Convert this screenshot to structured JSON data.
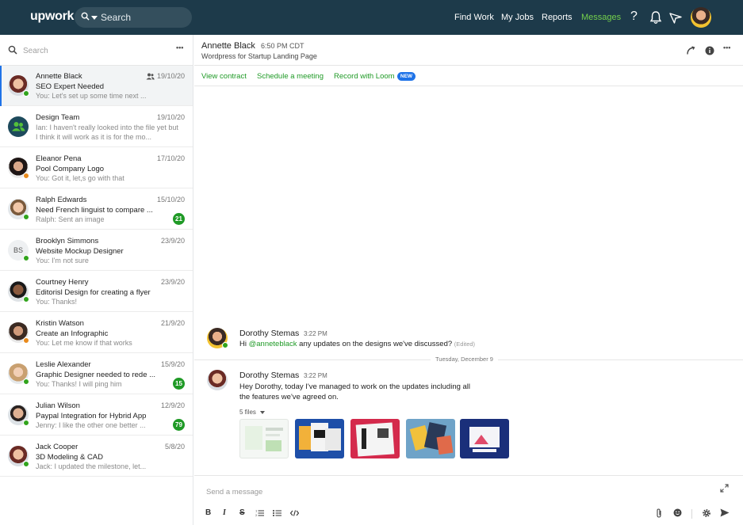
{
  "app": {
    "logo": "upwork"
  },
  "topbar": {
    "search_placeholder": "Search",
    "nav": [
      "Find Work",
      "My Jobs",
      "Reports",
      "Messages"
    ],
    "active_nav": "Messages",
    "help_label": "?"
  },
  "sidebar": {
    "search_placeholder": "Search",
    "more_label": "•••",
    "conversations": [
      {
        "name": "Annette Black",
        "date": "19/10/20",
        "title": "SEO Expert Needed",
        "preview": "You: Let's set up some time next ...",
        "selected": true,
        "group_icon": true,
        "status": "online"
      },
      {
        "name": "Design Team",
        "date": "19/10/20",
        "title": "Ian: I haven't really looked into the file yet but",
        "preview": "I think it will work as it is for the mo...",
        "status": "none"
      },
      {
        "name": "Eleanor Pena",
        "date": "17/10/20",
        "title": "Pool Company Logo",
        "preview": "You: Got it, let,s go with that",
        "status": "away"
      },
      {
        "name": "Ralph Edwards",
        "date": "15/10/20",
        "title": "Need French linguist to compare ...",
        "preview": "Ralph: Sent an image",
        "badge": "21",
        "status": "online"
      },
      {
        "name": "Brooklyn Simmons",
        "date": "23/9/20",
        "title": "Website Mockup Designer",
        "preview": "You: I'm not sure",
        "initials": "BS",
        "status": "online"
      },
      {
        "name": "Courtney Henry",
        "date": "23/9/20",
        "title": "Editorisl Design for creating a flyer",
        "preview": "You: Thanks!",
        "status": "online"
      },
      {
        "name": "Kristin Watson",
        "date": "21/9/20",
        "title": "Create an Infographic",
        "preview": "You: Let me know if that works",
        "status": "away"
      },
      {
        "name": "Leslie Alexander",
        "date": "15/9/20",
        "title": "Graphic Designer needed to rede ...",
        "preview": "You: Thanks! I will ping him",
        "badge": "15",
        "status": "online"
      },
      {
        "name": "Julian Wilson",
        "date": "12/9/20",
        "title": "Paypal Integration for Hybrid App",
        "preview": "Jenny: I like the other one better ...",
        "badge": "79",
        "status": "online"
      },
      {
        "name": "Jack Cooper",
        "date": "5/8/20",
        "title": "3D Modeling & CAD",
        "preview": "Jack: I updated the milestone, let...",
        "status": "online"
      }
    ]
  },
  "chat": {
    "contact_name": "Annette Black",
    "contact_time": "6:50 PM CDT",
    "job_title": "Wordpress for Startup Landing Page",
    "actions": [
      "View contract",
      "Schedule a meeting",
      "Record with Loom"
    ],
    "new_badge": "NEW",
    "messages": [
      {
        "author": "Dorothy Stemas",
        "time": "3:22 PM",
        "prefix": "Hi ",
        "mention": "@anneteblack",
        "text": " any updates on the designs we've discussed?",
        "edited": "(Edited)"
      },
      {
        "author": "Dorothy Stemas",
        "time": "3:22 PM",
        "line1": "Hey Dorothy, today I've managed to work on the updates including all",
        "line2": "the features we've agreed on.",
        "files_label": "5 files"
      }
    ],
    "date_divider": "Tuesday, December 9",
    "composer_placeholder": "Send a message"
  },
  "colors": {
    "topbar": "#1d3a4a",
    "accent_green": "#1f9a26",
    "active_nav": "#74d04c",
    "badge_blue": "#1f73e8"
  }
}
